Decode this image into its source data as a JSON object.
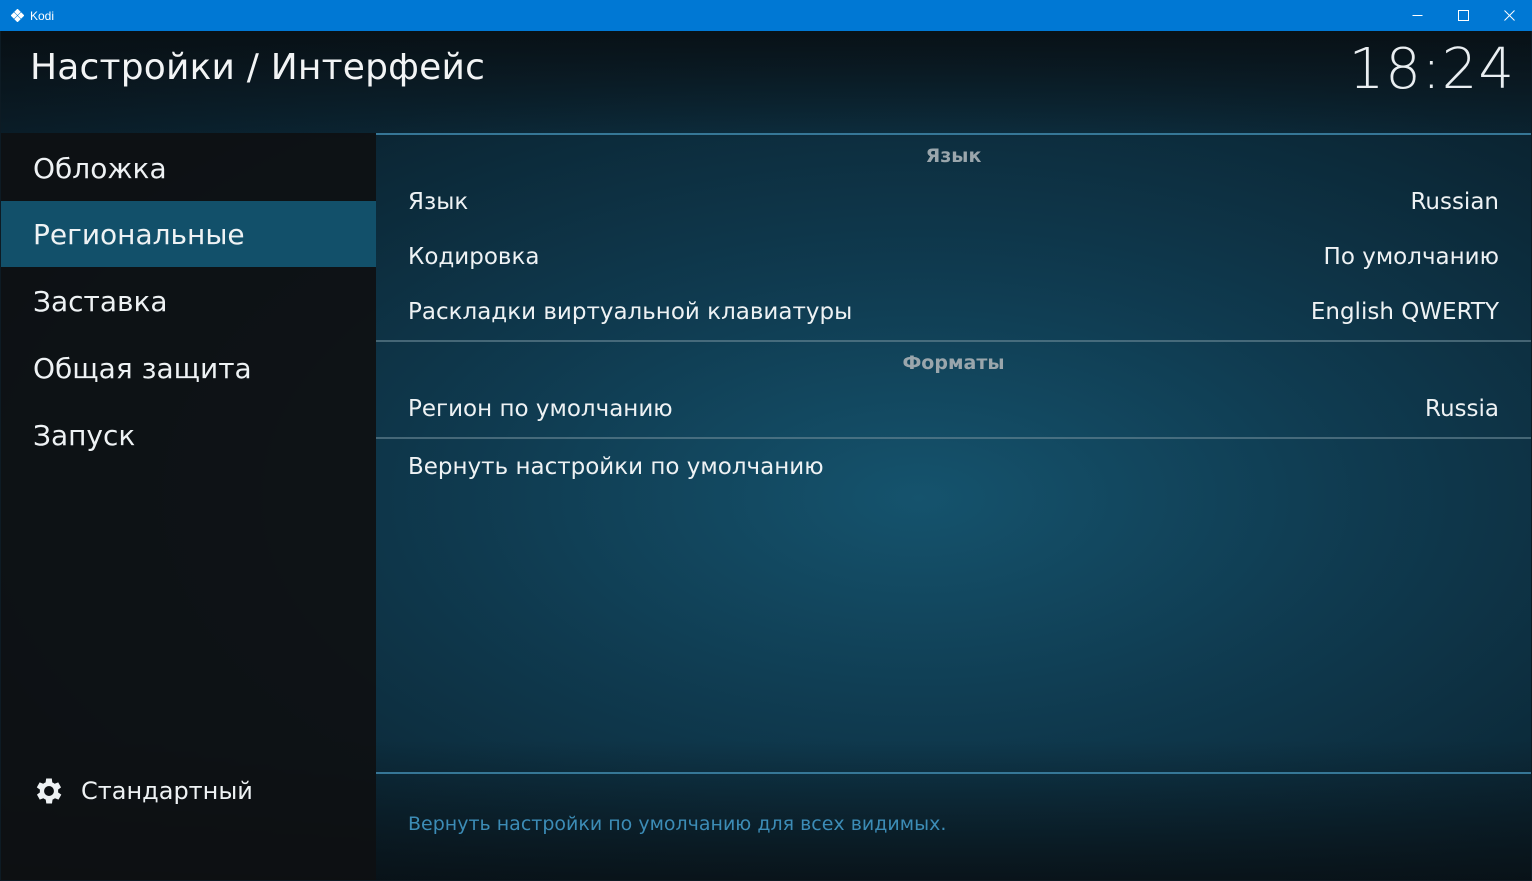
{
  "window": {
    "title": "Kodi",
    "controls": [
      "minimize-icon",
      "maximize-icon",
      "close-icon"
    ]
  },
  "header": {
    "title": "Настройки / Интерфейс",
    "clock": "18:24"
  },
  "sidebar": {
    "items": [
      {
        "label": "Обложка"
      },
      {
        "label": "Региональные",
        "active": true
      },
      {
        "label": "Заставка"
      },
      {
        "label": "Общая защита"
      },
      {
        "label": "Запуск"
      }
    ],
    "footer": {
      "icon": "gear-icon",
      "label": "Стандартный"
    }
  },
  "main": {
    "groups": [
      {
        "header": "Язык",
        "rows": [
          {
            "label": "Язык",
            "value": "Russian"
          },
          {
            "label": "Кодировка",
            "value": "По умолчанию"
          },
          {
            "label": "Раскладки виртуальной клавиатуры",
            "value": "English QWERTY"
          }
        ]
      },
      {
        "header": "Форматы",
        "rows": [
          {
            "label": "Регион по умолчанию",
            "value": "Russia"
          }
        ]
      }
    ],
    "reset_label": "Вернуть настройки по умолчанию",
    "hint": "Вернуть настройки по умолчанию для всех видимых."
  },
  "colors": {
    "titlebar": "#0078d4",
    "active_item": "#12506a",
    "hint_text": "#3c8cb6",
    "separator": "#3b7fa1"
  }
}
